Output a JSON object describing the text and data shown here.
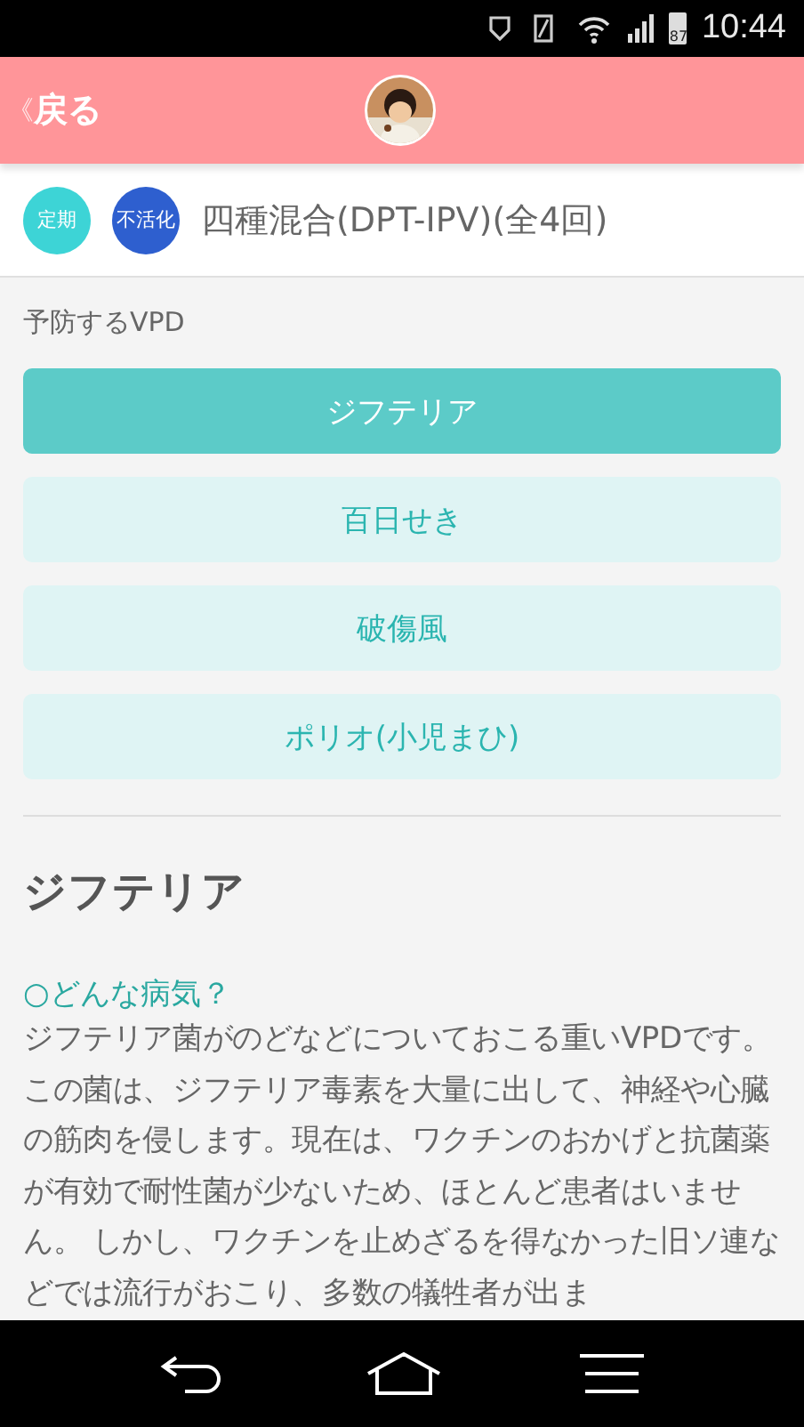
{
  "status_bar": {
    "battery_text": "87",
    "time": "10:44"
  },
  "header": {
    "back": "戻る",
    "back_icon": "《"
  },
  "vaccine": {
    "badges": [
      {
        "label": "定期",
        "color": "#3dd4d6"
      },
      {
        "label": "不活化",
        "color": "#2e5fcf"
      }
    ],
    "title": "四種混合(DPT-IPV)(全4回)"
  },
  "section_label": "予防するVPD",
  "diseases": [
    {
      "label": "ジフテリア",
      "selected": true
    },
    {
      "label": "百日せき",
      "selected": false
    },
    {
      "label": "破傷風",
      "selected": false
    },
    {
      "label": "ポリオ(小児まひ)",
      "selected": false
    }
  ],
  "detail": {
    "heading": "ジフテリア",
    "subheading": "○どんな病気？",
    "body": "ジフテリア菌がのどなどについておこる重いVPDです。この菌は、ジフテリア毒素を大量に出して、神経や心臓の筋肉を侵します。現在は、ワクチンのおかげと抗菌薬が有効で耐性菌が少ないため、ほとんど患者はいません。 しかし、ワクチンを止めざるを得なかった旧ソ連などでは流行がおこり、多数の犠牲者が出ま"
  }
}
